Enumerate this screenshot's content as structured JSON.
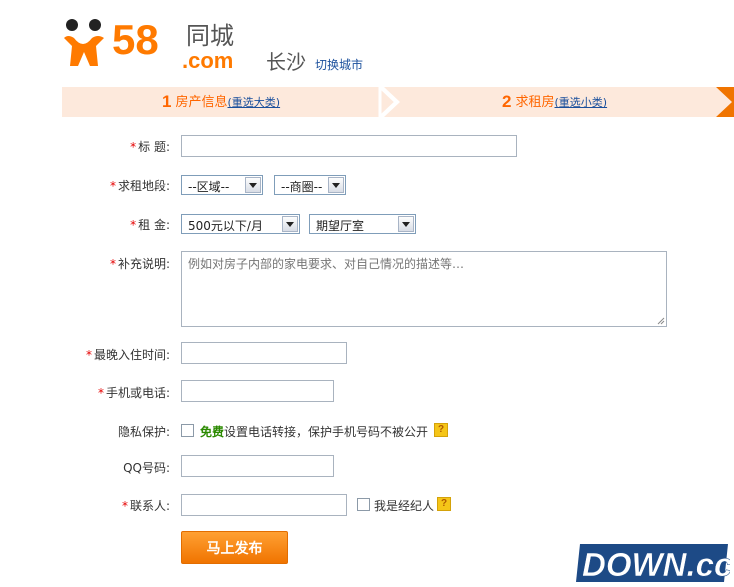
{
  "header": {
    "logo_number": "58",
    "logo_com": ".com",
    "logo_cn": "同城",
    "city": "长沙",
    "switch_city": "切换城市"
  },
  "steps": [
    {
      "number": "1",
      "label": "房产信息",
      "sub": "(重选大类)"
    },
    {
      "number": "2",
      "label": "求租房",
      "sub": "(重选小类)"
    }
  ],
  "colors": {
    "accent": "#ff6600",
    "link": "#1a4f9c",
    "required": "#e60000",
    "steps_bg": "#fde9dc"
  },
  "form": {
    "required_mark": "*",
    "title_label": "标 题:",
    "title_value": "",
    "area_label": "求租地段:",
    "district_selected": "--区域--",
    "zone_selected": "--商圈--",
    "rent_label": "租 金:",
    "rent_selected": "500元以下/月",
    "rooms_selected": "期望厅室",
    "desc_label": "补充说明:",
    "desc_placeholder": "例如对房子内部的家电要求、对自己情况的描述等…",
    "movein_label": "最晚入住时间:",
    "phone_label": "手机或电话:",
    "privacy_label": "隐私保护:",
    "privacy_free": "免费",
    "privacy_text": "设置电话转接，保护手机号码不被公开",
    "help": "?",
    "qq_label": "QQ号码:",
    "contact_label": "联系人:",
    "agent_text": "我是经纪人",
    "submit": "马上发布"
  },
  "watermark": {
    "text": "DOWN.cc"
  }
}
